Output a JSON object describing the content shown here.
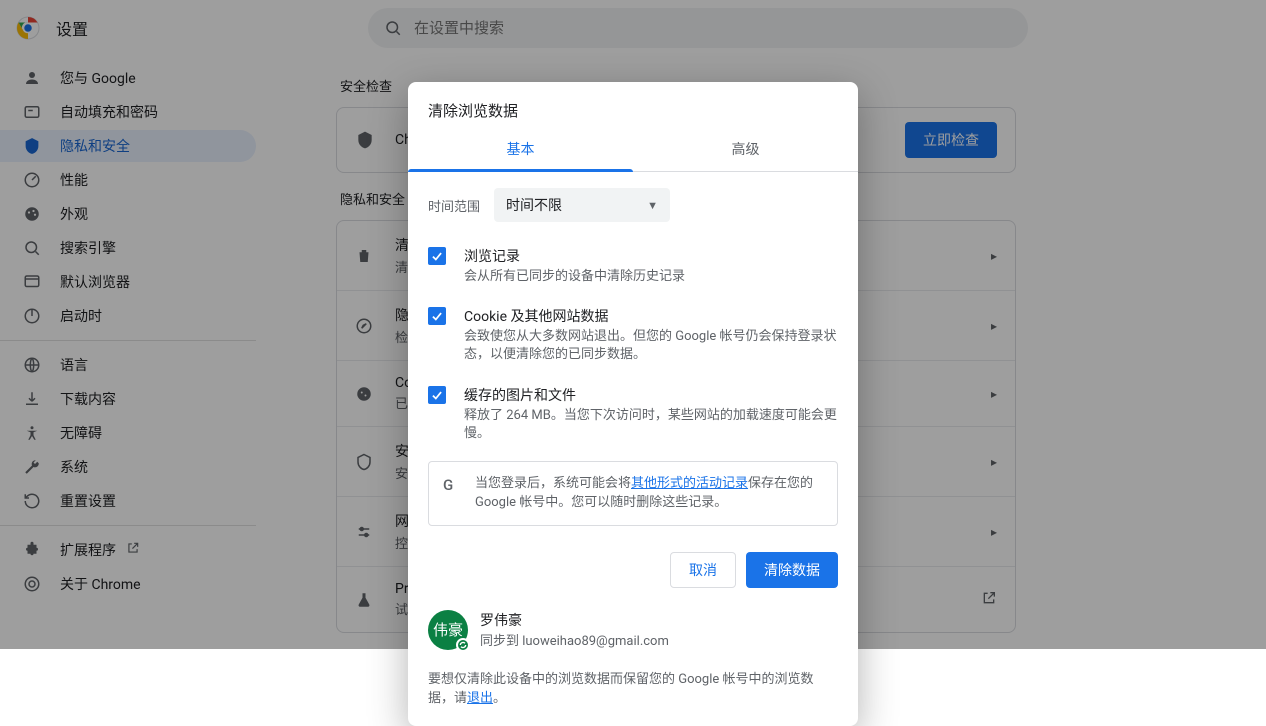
{
  "header": {
    "title": "设置",
    "search_placeholder": "在设置中搜索"
  },
  "sidebar": {
    "items": [
      {
        "label": "您与 Google"
      },
      {
        "label": "自动填充和密码"
      },
      {
        "label": "隐私和安全"
      },
      {
        "label": "性能"
      },
      {
        "label": "外观"
      },
      {
        "label": "搜索引擎"
      },
      {
        "label": "默认浏览器"
      },
      {
        "label": "启动时"
      }
    ],
    "items2": [
      {
        "label": "语言"
      },
      {
        "label": "下载内容"
      },
      {
        "label": "无障碍"
      },
      {
        "label": "系统"
      },
      {
        "label": "重置设置"
      }
    ],
    "items3": [
      {
        "label": "扩展程序"
      },
      {
        "label": "关于 Chrome"
      }
    ]
  },
  "main": {
    "section1_title": "安全检查",
    "safety_row": {
      "text": "Chro",
      "button": "立即检查"
    },
    "section2_title": "隐私和安全",
    "rows": [
      {
        "t1": "清除",
        "t2": "清除"
      },
      {
        "t1": "隐私",
        "t2": "检查"
      },
      {
        "t1": "Coo",
        "t2": "已阻"
      },
      {
        "t1": "安全",
        "t2": "安全"
      },
      {
        "t1": "网站",
        "t2": "控制"
      },
      {
        "t1": "Priv",
        "t2": "试用"
      }
    ]
  },
  "dialog": {
    "title": "清除浏览数据",
    "tabs": {
      "basic": "基本",
      "advanced": "高级"
    },
    "time_label": "时间范围",
    "time_value": "时间不限",
    "checks": [
      {
        "title": "浏览记录",
        "desc": "会从所有已同步的设备中清除历史记录"
      },
      {
        "title": "Cookie 及其他网站数据",
        "desc": "会致使您从大多数网站退出。但您的 Google 帐号仍会保持登录状态，以便清除您的已同步数据。"
      },
      {
        "title": "缓存的图片和文件",
        "desc": "释放了 264 MB。当您下次访问时，某些网站的加载速度可能会更慢。"
      }
    ],
    "info_prefix": "当您登录后，系统可能会将",
    "info_link": "其他形式的活动记录",
    "info_suffix": "保存在您的 Google 帐号中。您可以随时删除这些记录。",
    "cancel": "取消",
    "confirm": "清除数据",
    "avatar_text": "伟豪",
    "profile_name": "罗伟豪",
    "profile_sync_prefix": "同步到 ",
    "profile_email": "luoweihao89@gmail.com",
    "footer_prefix": "要想仅清除此设备中的浏览数据而保留您的 Google 帐号中的浏览数据，请",
    "footer_link": "退出",
    "footer_suffix": "。"
  }
}
